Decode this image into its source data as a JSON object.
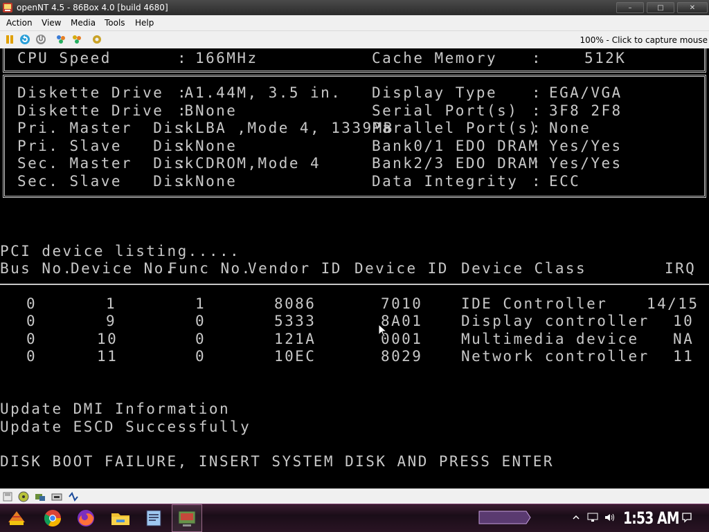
{
  "window": {
    "title": "openNT 4.5 - 86Box 4.0 [build 4680]",
    "min_glyph": "–",
    "max_glyph": "□",
    "close_glyph": "✕"
  },
  "menu": {
    "action": "Action",
    "view": "View",
    "media": "Media",
    "tools": "Tools",
    "help": "Help"
  },
  "toolbar": {
    "capture_hint": "100% - Click to capture mouse"
  },
  "bios": {
    "cpu_speed_label": "CPU Speed",
    "cpu_speed_value": "166MHz",
    "cache_label": "Cache Memory",
    "cache_value": "512K",
    "left_rows": [
      {
        "label": "Diskette Drive  A",
        "value": "1.44M, 3.5 in."
      },
      {
        "label": "Diskette Drive  B",
        "value": "None"
      },
      {
        "label": "Pri. Master  Disk",
        "value": "LBA ,Mode 4, 1339MB"
      },
      {
        "label": "Pri. Slave   Disk",
        "value": "None"
      },
      {
        "label": "Sec. Master  Disk",
        "value": "CDROM,Mode 4"
      },
      {
        "label": "Sec. Slave   Disk",
        "value": "None"
      }
    ],
    "right_rows": [
      {
        "label": "Display Type",
        "value": "EGA/VGA"
      },
      {
        "label": "Serial Port(s)",
        "value": "3F8 2F8"
      },
      {
        "label": "Parallel Port(s)",
        "value": "None"
      },
      {
        "label": "Bank0/1 EDO DRAM",
        "value": "Yes/Yes"
      },
      {
        "label": "Bank2/3 EDO DRAM",
        "value": "Yes/Yes"
      },
      {
        "label": "Data Integrity",
        "value": "ECC"
      }
    ],
    "pci_title": "PCI device listing.....",
    "pci_headers": {
      "bus": "Bus No.",
      "device": "Device No.",
      "func": "Func No.",
      "vendor": "Vendor ID",
      "device_id": "Device ID",
      "class": "Device Class",
      "irq": "IRQ"
    },
    "pci_rows": [
      {
        "bus": "0",
        "device": "1",
        "func": "1",
        "vendor": "8086",
        "device_id": "7010",
        "class": "IDE Controller",
        "irq": "14/15"
      },
      {
        "bus": "0",
        "device": "9",
        "func": "0",
        "vendor": "5333",
        "device_id": "8A01",
        "class": "Display controller",
        "irq": "10"
      },
      {
        "bus": "0",
        "device": "10",
        "func": "0",
        "vendor": "121A",
        "device_id": "0001",
        "class": "Multimedia device",
        "irq": "NA"
      },
      {
        "bus": "0",
        "device": "11",
        "func": "0",
        "vendor": "10EC",
        "device_id": "8029",
        "class": "Network controller",
        "irq": "11"
      }
    ],
    "dmi_line": "Update DMI Information",
    "escd_line": "Update ESCD Successfully",
    "boot_failure": "DISK BOOT FAILURE, INSERT SYSTEM DISK AND PRESS ENTER",
    "colon": ":"
  },
  "taskbar": {
    "clock": "1:53 AM"
  }
}
